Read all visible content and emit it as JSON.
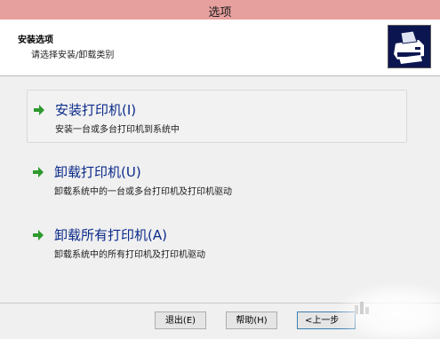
{
  "window": {
    "title": "选项"
  },
  "header": {
    "title": "安装选项",
    "subtitle": "请选择安装/卸载类别"
  },
  "options": [
    {
      "label": "安装打印机(I)",
      "description": "安装一台或多台打印机到系统中"
    },
    {
      "label": "卸载打印机(U)",
      "description": "卸载系统中的一台或多台打印机及打印机驱动"
    },
    {
      "label": "卸载所有打印机(A)",
      "description": "卸载系统中的所有打印机及打印机驱动"
    }
  ],
  "footer": {
    "exit_label": "退出(E)",
    "help_label": "帮助(H)",
    "back_label": "<上一步"
  },
  "colors": {
    "titlebar": "#e6a09e",
    "link": "#0a2a8a",
    "arrow": "#2e9a2e",
    "logo_bg": "#0b1550"
  },
  "icons": {
    "logo": "printer-logo-icon",
    "option_arrow": "green-arrow-icon"
  }
}
